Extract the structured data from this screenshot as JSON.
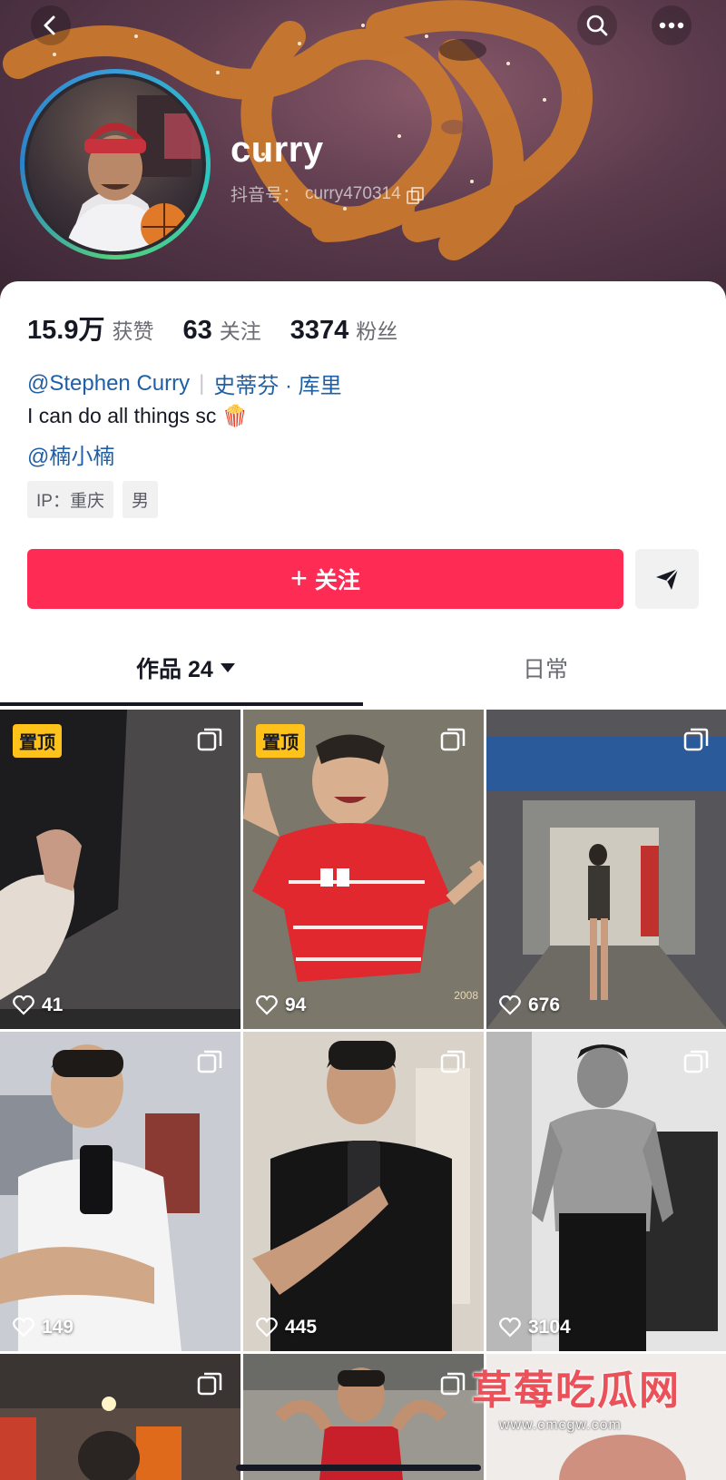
{
  "header": {
    "nickname": "curry",
    "handle_prefix": "抖音号：",
    "handle": "curry470314",
    "icons": {
      "back": "chevron-left-icon",
      "search": "search-icon",
      "more": "more-dots-icon"
    }
  },
  "stats": [
    {
      "value": "15.9万",
      "label": "获赞"
    },
    {
      "value": "63",
      "label": "关注"
    },
    {
      "value": "3374",
      "label": "粉丝"
    }
  ],
  "profile": {
    "mention_name": "@Stephen Curry",
    "mention_separator": "|",
    "mention_cn": "史蒂芬 · 库里",
    "bio": "I can do all things sc 🍿",
    "mention2": "@楠小楠",
    "tags": [
      "IP：重庆",
      "男"
    ]
  },
  "actions": {
    "follow_label": "关注",
    "follow_plus": "+",
    "share_icon": "send-icon"
  },
  "tabs": {
    "works_label": "作品 24",
    "daily_label": "日常"
  },
  "videos": [
    {
      "pinned": true,
      "pin_label": "置顶",
      "likes": "41"
    },
    {
      "pinned": true,
      "pin_label": "置顶",
      "likes": "94",
      "photo_year": "2008"
    },
    {
      "pinned": false,
      "likes": "676"
    },
    {
      "pinned": false,
      "likes": "149"
    },
    {
      "pinned": false,
      "likes": "445"
    },
    {
      "pinned": false,
      "likes": "3104"
    },
    {
      "pinned": false,
      "likes": ""
    },
    {
      "pinned": false,
      "likes": ""
    },
    {
      "pinned": false,
      "likes": ""
    }
  ],
  "watermark": {
    "title": "草莓吃瓜网",
    "url": "www.cmcgw.com"
  },
  "colors": {
    "accent": "#fe2c55",
    "link": "#1f5fa5",
    "pin": "#ffc21a"
  }
}
